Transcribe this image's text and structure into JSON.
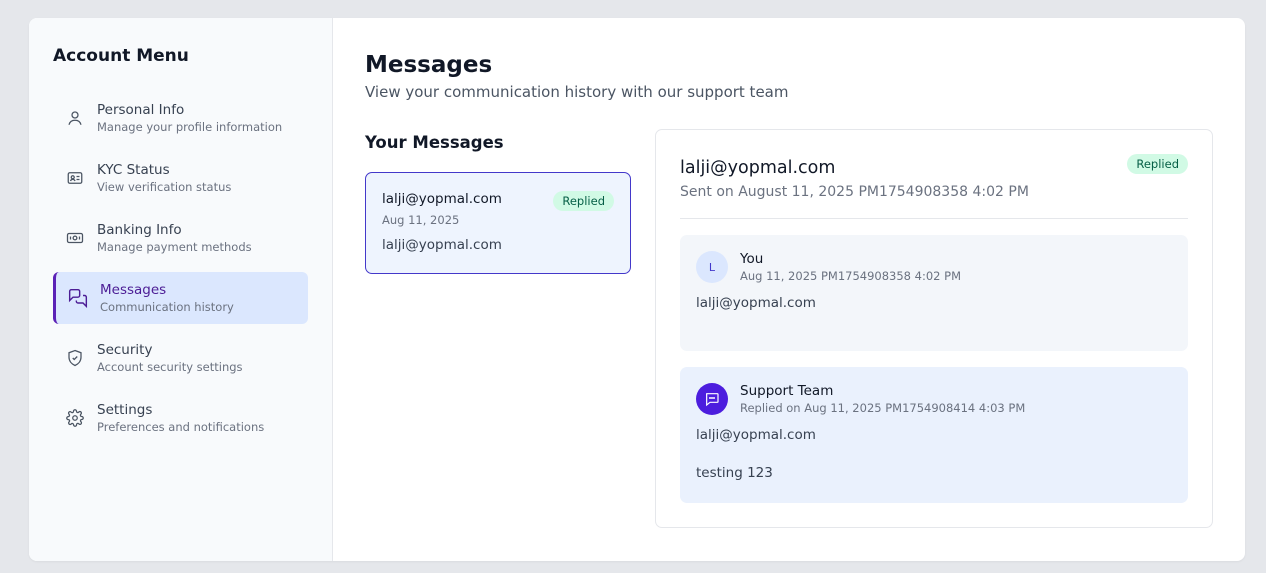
{
  "sidebar": {
    "title": "Account Menu",
    "items": [
      {
        "label": "Personal Info",
        "sub": "Manage your profile information",
        "icon": "user-icon"
      },
      {
        "label": "KYC Status",
        "sub": "View verification status",
        "icon": "id-card-icon"
      },
      {
        "label": "Banking Info",
        "sub": "Manage payment methods",
        "icon": "banknote-icon"
      },
      {
        "label": "Messages",
        "sub": "Communication history",
        "icon": "messages-icon",
        "active": true
      },
      {
        "label": "Security",
        "sub": "Account security settings",
        "icon": "shield-check-icon"
      },
      {
        "label": "Settings",
        "sub": "Preferences and notifications",
        "icon": "gear-icon"
      }
    ]
  },
  "main": {
    "title": "Messages",
    "subtitle": "View your communication history with our support team"
  },
  "list": {
    "heading": "Your Messages",
    "messages": [
      {
        "from": "lalji@yopmal.com",
        "date": "Aug 11, 2025",
        "preview": "lalji@yopmal.com",
        "status": "Replied"
      }
    ]
  },
  "detail": {
    "from": "lalji@yopmal.com",
    "sent": "Sent on August 11, 2025 PM1754908358 4:02 PM",
    "status": "Replied",
    "you": {
      "avatar": "L",
      "name": "You",
      "time": "Aug 11, 2025 PM1754908358 4:02 PM",
      "text": "lalji@yopmal.com"
    },
    "support": {
      "name": "Support Team",
      "time": "Replied on Aug 11, 2025 PM1754908414 4:03 PM",
      "text": "lalji@yopmal.com",
      "text2": "testing 123"
    }
  },
  "colors": {
    "accent": "#4c1d95",
    "active_bg": "#dbe7fe",
    "badge_bg": "#d1fae5",
    "badge_text": "#065f46"
  }
}
